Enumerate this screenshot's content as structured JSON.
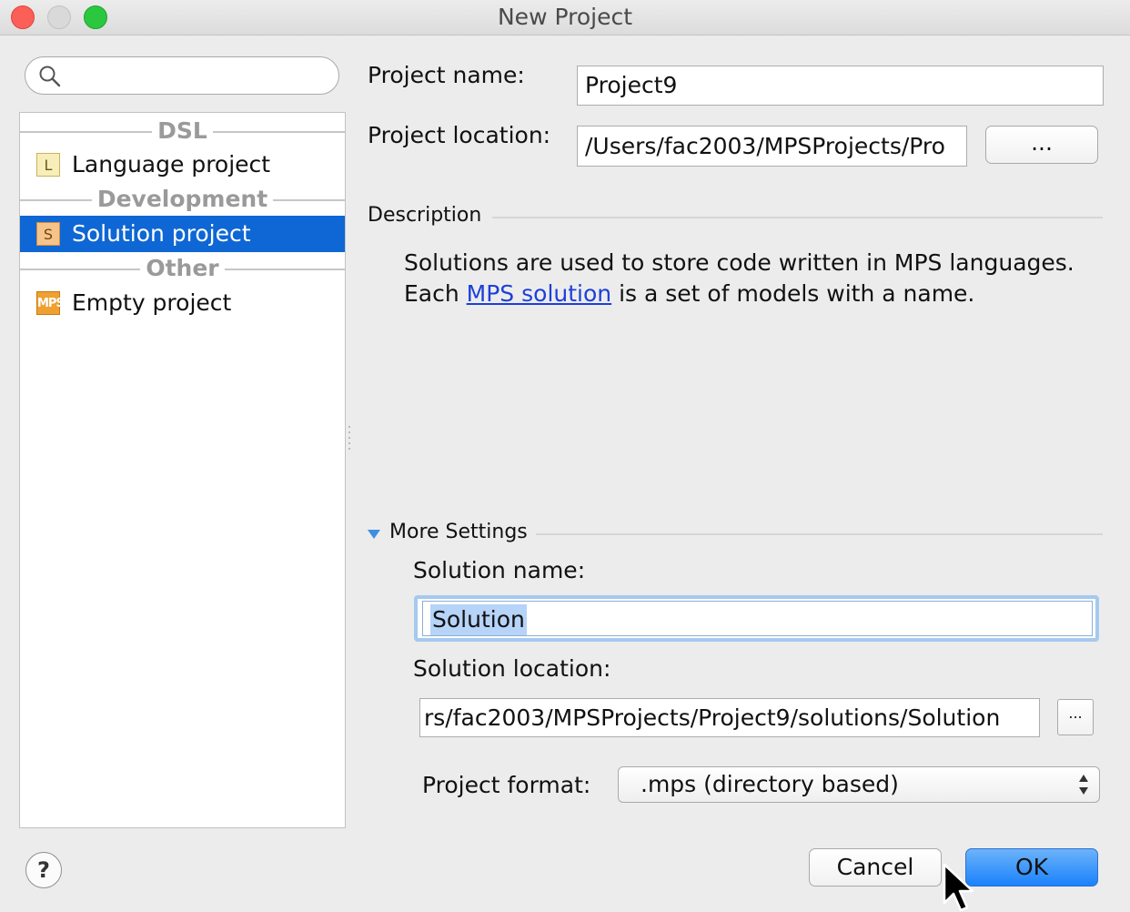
{
  "window": {
    "title": "New Project",
    "accent": "#0e67d4"
  },
  "sidebar": {
    "search": {
      "value": "",
      "placeholder": "",
      "icon": "search-icon"
    },
    "groups": [
      {
        "label": "DSL",
        "items": [
          {
            "label": "Language project",
            "icon": "L",
            "icon_name": "language-icon"
          }
        ]
      },
      {
        "label": "Development",
        "items": [
          {
            "label": "Solution project",
            "icon": "S",
            "icon_name": "solution-icon",
            "selected": true
          }
        ]
      },
      {
        "label": "Other",
        "items": [
          {
            "label": "Empty project",
            "icon": "MPS",
            "icon_name": "mps-logo-icon"
          }
        ]
      }
    ]
  },
  "form": {
    "project_name_label": "Project name:",
    "project_name_value": "Project9",
    "project_location_label": "Project location:",
    "project_location_value": "/Users/fac2003/MPSProjects/Pro",
    "browse_label": "...",
    "description_label": "Description",
    "description_text_before": "Solutions are used to store code written in MPS languages. Each ",
    "description_link": "MPS solution",
    "description_text_after": " is a set of models with a name.",
    "more_settings_label": "More Settings",
    "solution_name_label": "Solution name:",
    "solution_name_value": "Solution",
    "solution_location_label": "Solution location:",
    "solution_location_value": "rs/fac2003/MPSProjects/Project9/solutions/Solution",
    "solution_browse_label": "...",
    "project_format_label": "Project format:",
    "project_format_value": ".mps (directory based)"
  },
  "footer": {
    "help_label": "?",
    "cancel_label": "Cancel",
    "ok_label": "OK"
  }
}
